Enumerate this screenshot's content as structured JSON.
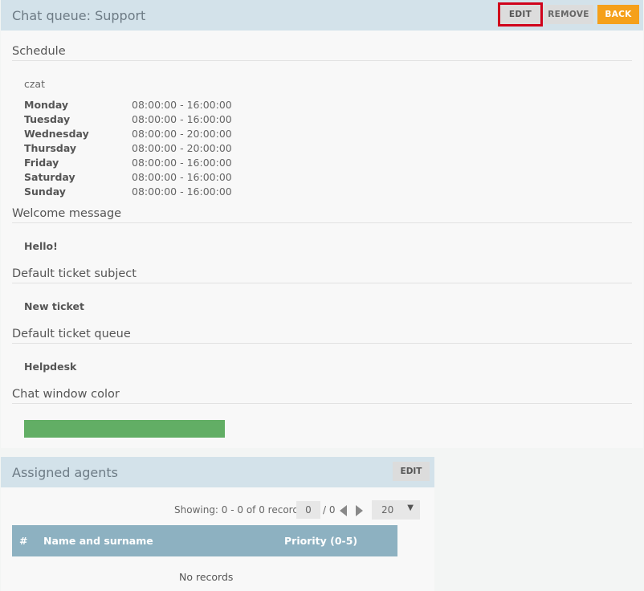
{
  "header": {
    "title": "Chat queue: Support",
    "edit_label": "EDIT",
    "remove_label": "REMOVE",
    "back_label": "BACK"
  },
  "schedule": {
    "section_title": "Schedule",
    "name": "czat",
    "days": [
      {
        "day": "Monday",
        "hours": "08:00:00 - 16:00:00"
      },
      {
        "day": "Tuesday",
        "hours": "08:00:00 - 16:00:00"
      },
      {
        "day": "Wednesday",
        "hours": "08:00:00 - 20:00:00"
      },
      {
        "day": "Thursday",
        "hours": "08:00:00 - 20:00:00"
      },
      {
        "day": "Friday",
        "hours": "08:00:00 - 16:00:00"
      },
      {
        "day": "Saturday",
        "hours": "08:00:00 - 16:00:00"
      },
      {
        "day": "Sunday",
        "hours": "08:00:00 - 16:00:00"
      }
    ]
  },
  "welcome": {
    "section_title": "Welcome message",
    "value": "Hello!"
  },
  "ticket_subject": {
    "section_title": "Default ticket subject",
    "value": "New ticket"
  },
  "ticket_queue": {
    "section_title": "Default ticket queue",
    "value": "Helpdesk"
  },
  "chat_color": {
    "section_title": "Chat window color",
    "color": "#62ae65"
  },
  "agents": {
    "title": "Assigned agents",
    "edit_label": "EDIT",
    "showing": "Showing: 0 - 0 of 0 records",
    "page_value": "0",
    "page_total": "/ 0",
    "page_size": "20",
    "columns": [
      "#",
      "Name and surname",
      "Priority (0-5)"
    ],
    "empty_text": "No records"
  }
}
